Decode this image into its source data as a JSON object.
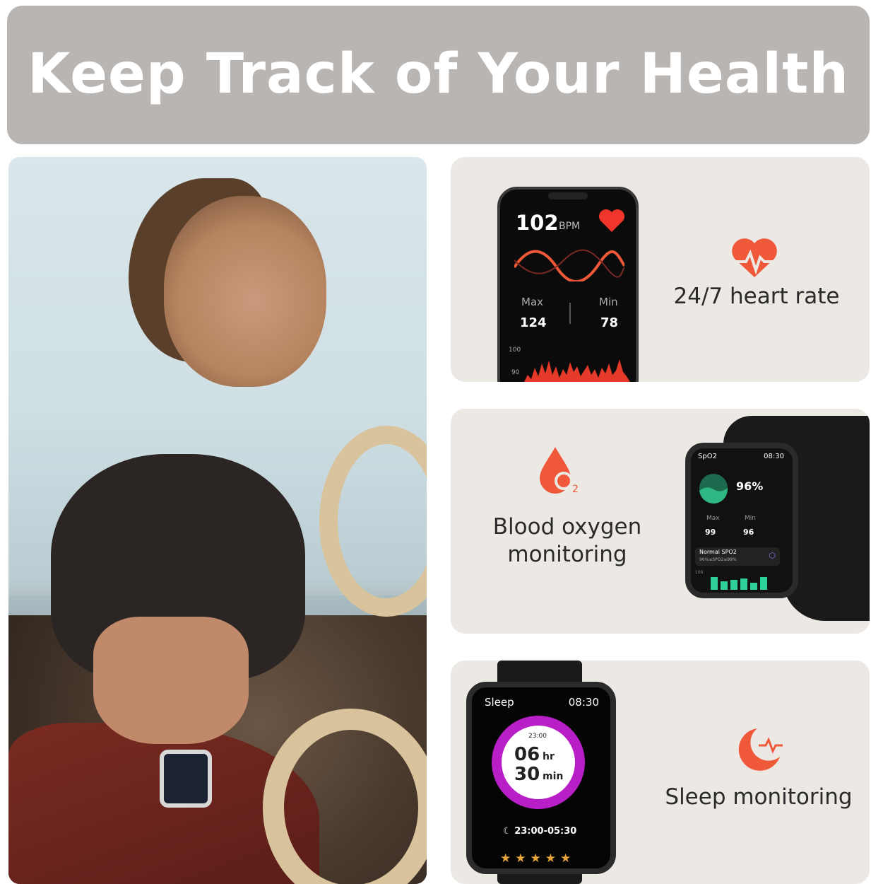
{
  "header": {
    "title": "Keep Track of Your Health"
  },
  "features": [
    {
      "label": "24/7 heart rate",
      "icon": "heart-rate-icon",
      "color": "#f0583a"
    },
    {
      "label_line1": "Blood oxygen",
      "label_line2": "monitoring",
      "icon": "blood-oxygen-icon",
      "color": "#f0583a"
    },
    {
      "label": "Sleep monitoring",
      "icon": "sleep-moon-icon",
      "color": "#f0583a"
    }
  ],
  "phone_screen": {
    "bpm": "102",
    "bpm_unit": "BPM",
    "max_label": "Max",
    "max_value": "124",
    "min_label": "Min",
    "min_value": "78",
    "axis_top": "100",
    "axis_mid": "90"
  },
  "spo2_screen": {
    "title": "SpO2",
    "time": "08:30",
    "value": "96%",
    "max_label": "Max",
    "max_value": "99",
    "min_label": "Min",
    "min_value": "96",
    "status": "Normal SPO2",
    "range": "96%≤SPO2≤99%",
    "axis": "100"
  },
  "sleep_screen": {
    "title": "Sleep",
    "time": "08:30",
    "start": "23:00",
    "hours": "06",
    "hours_unit": "hr",
    "minutes": "30",
    "minutes_unit": "min",
    "range": "23:00-05:30",
    "stars": "★★★★★"
  }
}
